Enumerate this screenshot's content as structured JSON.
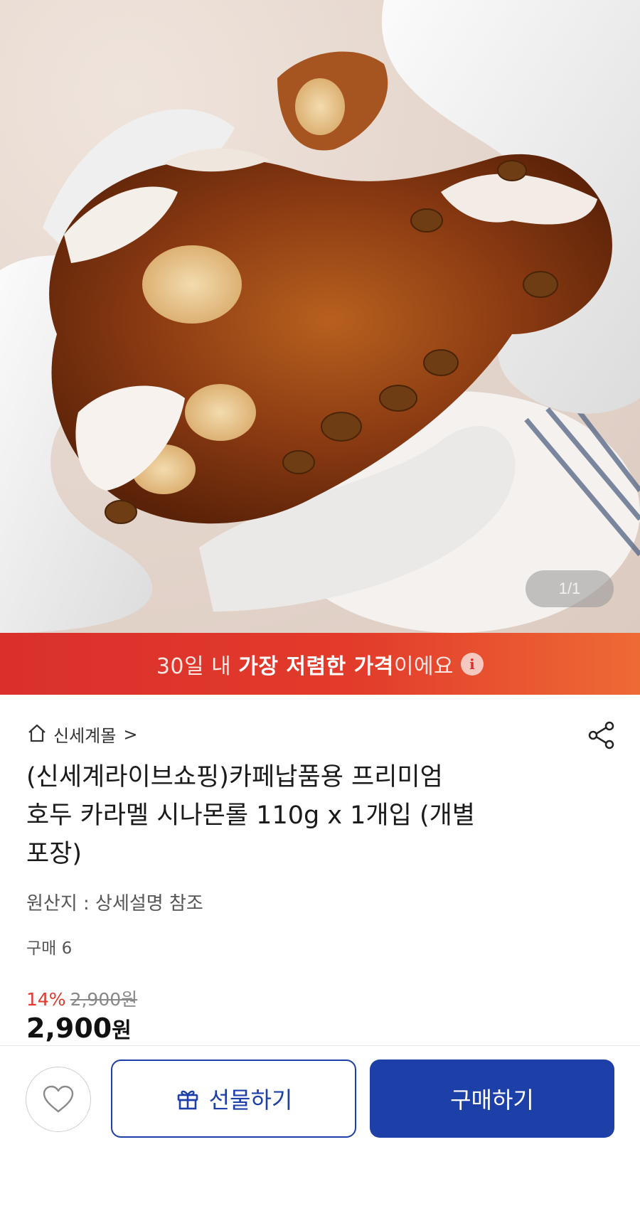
{
  "gallery": {
    "image_alt": "cinnamon roll held in gloved hands",
    "counter": "1/1"
  },
  "banner": {
    "prefix": "30일 내 ",
    "highlight": "가장 저렴한 가격",
    "suffix": "이에요",
    "info_icon": "i"
  },
  "store": {
    "home_icon": "home-icon",
    "name": "신세계몰",
    "chevron": ">",
    "share_icon": "share-icon"
  },
  "product": {
    "title_line1": "(신세계라이브쇼핑)카페납품용 프리미엄",
    "title_line2": "호두 카라멜 시나몬롤 110g x 1개입 (개별",
    "title_line3": "포장)",
    "origin": "원산지 : 상세설명 참조",
    "purchase_count": "구매 6"
  },
  "price": {
    "discount": "14%",
    "original": "2,900원",
    "final": "2,900",
    "unit": "원"
  },
  "actions": {
    "wish_icon": "heart-icon",
    "gift_icon": "gift-icon",
    "gift_label": "선물하기",
    "buy_label": "구매하기"
  },
  "colors": {
    "brand_blue": "#1c3fa8",
    "banner_red": "#e23b2b",
    "discount_red": "#e0382d"
  }
}
